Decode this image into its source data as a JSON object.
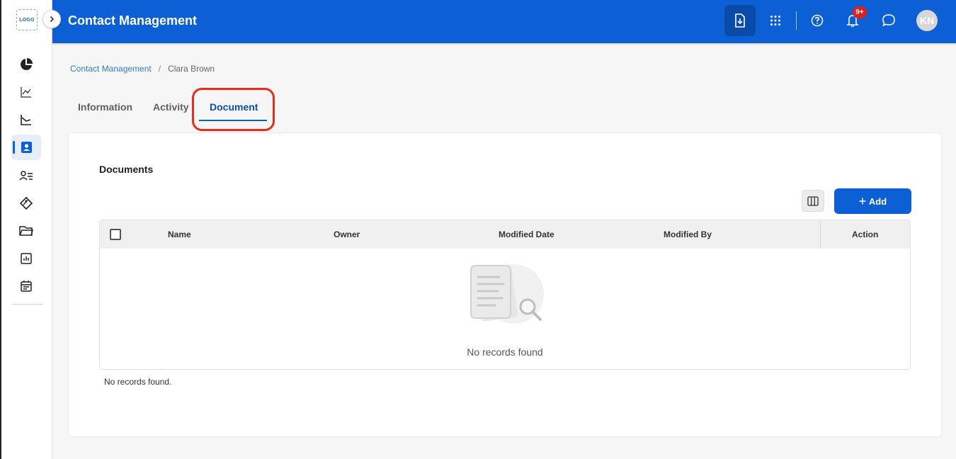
{
  "app": {
    "logo_text": "LOGO",
    "title": "Contact Management"
  },
  "header": {
    "notification_badge": "9+",
    "avatar_initials": "KN"
  },
  "sidebar": {
    "items": [
      {
        "name": "pie-chart-icon"
      },
      {
        "name": "line-chart-icon"
      },
      {
        "name": "area-chart-icon"
      },
      {
        "name": "contacts-icon",
        "active": true
      },
      {
        "name": "user-list-icon"
      },
      {
        "name": "tag-icon"
      },
      {
        "name": "folder-icon"
      },
      {
        "name": "report-icon"
      },
      {
        "name": "calendar-icon"
      }
    ]
  },
  "breadcrumb": {
    "parent": "Contact Management",
    "separator": "/",
    "current": "Clara Brown"
  },
  "tabs": [
    {
      "label": "Information"
    },
    {
      "label": "Activity"
    },
    {
      "label": "Document",
      "active": true
    }
  ],
  "documents": {
    "title": "Documents",
    "add_label": "Add",
    "columns": [
      "Name",
      "Owner",
      "Modified Date",
      "Modified By",
      "Action"
    ],
    "empty_text": "No records found",
    "footer_note": "No records found."
  },
  "colors": {
    "primary": "#0d5fd6",
    "highlight": "#ec2b19",
    "badge": "#e0201b"
  }
}
